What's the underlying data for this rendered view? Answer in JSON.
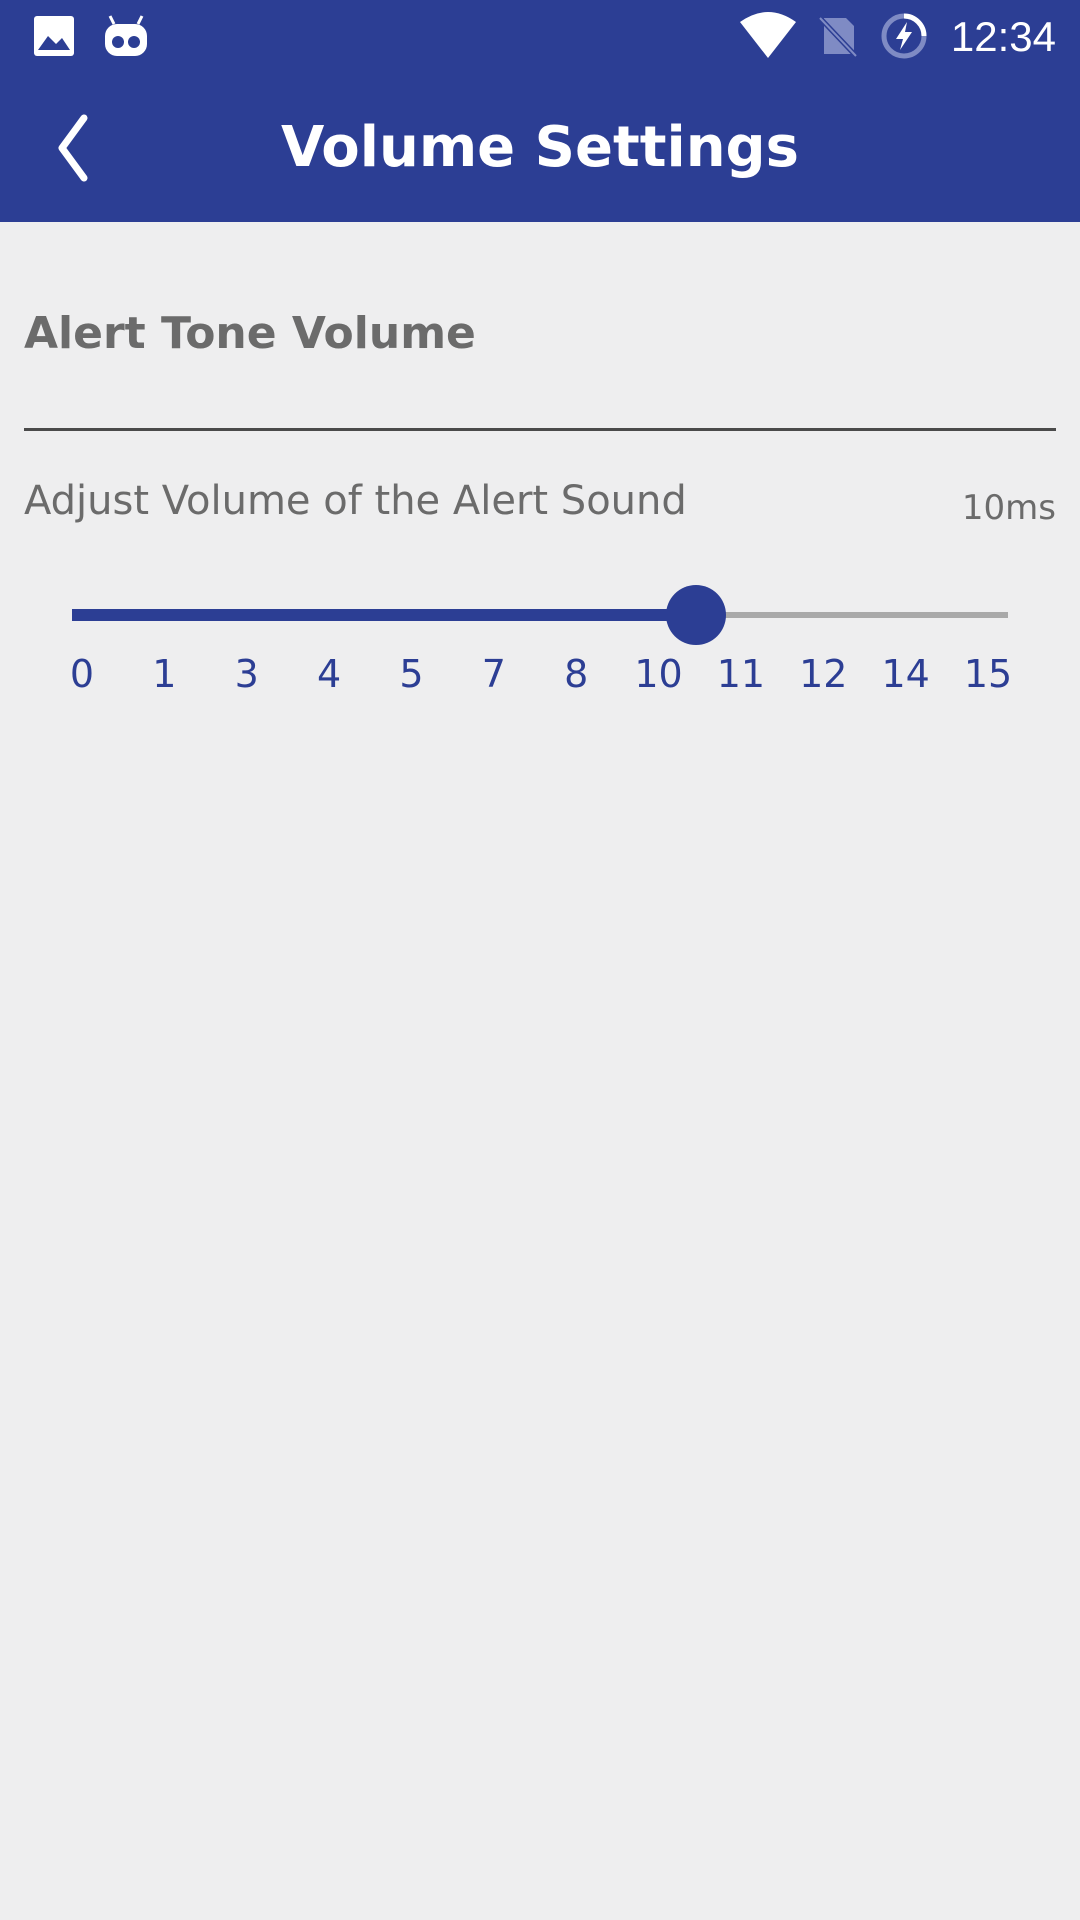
{
  "status_bar": {
    "time": "12:34",
    "icons": [
      "image-icon",
      "robot-icon",
      "wifi-icon",
      "no-sim-icon",
      "battery-charging-icon"
    ]
  },
  "app_bar": {
    "title": "Volume Settings",
    "back_icon": "chevron-left-icon"
  },
  "section": {
    "title": "Alert Tone Volume"
  },
  "setting": {
    "label": "Adjust Volume of the Alert Sound",
    "value_text": "10ms",
    "slider": {
      "min": 0,
      "max": 15,
      "value": 10,
      "tick_labels": [
        "0",
        "1",
        "3",
        "4",
        "5",
        "7",
        "8",
        "10",
        "11",
        "12",
        "14",
        "15"
      ]
    }
  },
  "colors": {
    "primary": "#2c3e94",
    "background": "#eeeeef",
    "text_muted": "#6b6b6b",
    "track_inactive": "#a9a9a9"
  }
}
